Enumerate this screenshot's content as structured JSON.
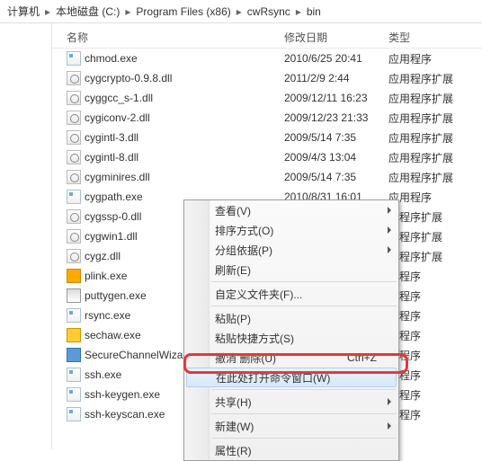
{
  "breadcrumb": [
    "计算机",
    "本地磁盘 (C:)",
    "Program Files (x86)",
    "cwRsync",
    "bin"
  ],
  "columns": {
    "name": "名称",
    "date": "修改日期",
    "type": "类型"
  },
  "files": [
    {
      "icon": "exe",
      "name": "chmod.exe",
      "date": "2010/6/25 20:41",
      "type": "应用程序"
    },
    {
      "icon": "dll",
      "name": "cygcrypto-0.9.8.dll",
      "date": "2011/2/9 2:44",
      "type": "应用程序扩展"
    },
    {
      "icon": "dll",
      "name": "cyggcc_s-1.dll",
      "date": "2009/12/11 16:23",
      "type": "应用程序扩展"
    },
    {
      "icon": "dll",
      "name": "cygiconv-2.dll",
      "date": "2009/12/23 21:33",
      "type": "应用程序扩展"
    },
    {
      "icon": "dll",
      "name": "cygintl-3.dll",
      "date": "2009/5/14 7:35",
      "type": "应用程序扩展"
    },
    {
      "icon": "dll",
      "name": "cygintl-8.dll",
      "date": "2009/4/3 13:04",
      "type": "应用程序扩展"
    },
    {
      "icon": "dll",
      "name": "cygminires.dll",
      "date": "2009/5/14 7:35",
      "type": "应用程序扩展"
    },
    {
      "icon": "exe",
      "name": "cygpath.exe",
      "date": "2010/8/31 16:01",
      "type": "应用程序"
    },
    {
      "icon": "dll",
      "name": "cygssp-0.dll",
      "date": "",
      "type": "用程序扩展"
    },
    {
      "icon": "dll",
      "name": "cygwin1.dll",
      "date": "",
      "type": "用程序扩展"
    },
    {
      "icon": "dll",
      "name": "cygz.dll",
      "date": "",
      "type": "用程序扩展"
    },
    {
      "icon": "plink",
      "name": "plink.exe",
      "date": "",
      "type": "用程序"
    },
    {
      "icon": "putty",
      "name": "puttygen.exe",
      "date": "",
      "type": "用程序"
    },
    {
      "icon": "exe",
      "name": "rsync.exe",
      "date": "",
      "type": "用程序"
    },
    {
      "icon": "sechaw",
      "name": "sechaw.exe",
      "date": "",
      "type": "用程序"
    },
    {
      "icon": "scw",
      "name": "SecureChannelWizar",
      "date": "",
      "type": "用程序"
    },
    {
      "icon": "exe",
      "name": "ssh.exe",
      "date": "",
      "type": "用程序"
    },
    {
      "icon": "exe",
      "name": "ssh-keygen.exe",
      "date": "",
      "type": "用程序"
    },
    {
      "icon": "exe",
      "name": "ssh-keyscan.exe",
      "date": "",
      "type": "用程序"
    }
  ],
  "ctx": {
    "view": "查看(V)",
    "sort": "排序方式(O)",
    "group": "分组依据(P)",
    "refresh": "刷新(E)",
    "custom": "自定义文件夹(F)...",
    "paste": "粘贴(P)",
    "pasteShortcut": "粘贴快捷方式(S)",
    "undo": "撤消 删除(U)",
    "undoKey": "Ctrl+Z",
    "openCmd": "在此处打开命令窗口(W)",
    "share": "共享(H)",
    "new": "新建(W)",
    "props": "属性(R)"
  }
}
